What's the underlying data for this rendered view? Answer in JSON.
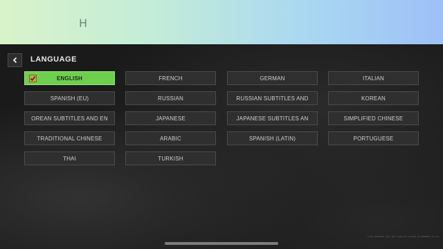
{
  "banner": {
    "letter": "H"
  },
  "header": {
    "title": "LANGUAGE",
    "back_icon": "back-arrow-icon"
  },
  "languages": [
    {
      "label": "ENGLISH",
      "selected": true
    },
    {
      "label": "FRENCH"
    },
    {
      "label": "GERMAN"
    },
    {
      "label": "ITALIAN"
    },
    {
      "label": "SPANISH (EU)"
    },
    {
      "label": "RUSSIAN"
    },
    {
      "label": "RUSSIAN SUBTITLES AND"
    },
    {
      "label": "KOREAN"
    },
    {
      "label": "OREAN SUBTITLES AND EN"
    },
    {
      "label": "JAPANESE"
    },
    {
      "label": "JAPANESE SUBTITLES AN"
    },
    {
      "label": "SIMPLIFIED CHINESE"
    },
    {
      "label": "TRADITIONAL CHINESE"
    },
    {
      "label": "ARABIC"
    },
    {
      "label": "SPANISH (LATIN)"
    },
    {
      "label": "PORTUGUESE"
    },
    {
      "label": "THAI"
    },
    {
      "label": "TURKISH"
    }
  ],
  "footer": {
    "build_info": "8.00.77064498 [33] 250 7[48+173.17+903] ET-9000007 ub 0.0"
  },
  "colors": {
    "selected": "#6ecf4f",
    "button": "#2f2f2f",
    "accent_banner": "#a9d7f1"
  }
}
